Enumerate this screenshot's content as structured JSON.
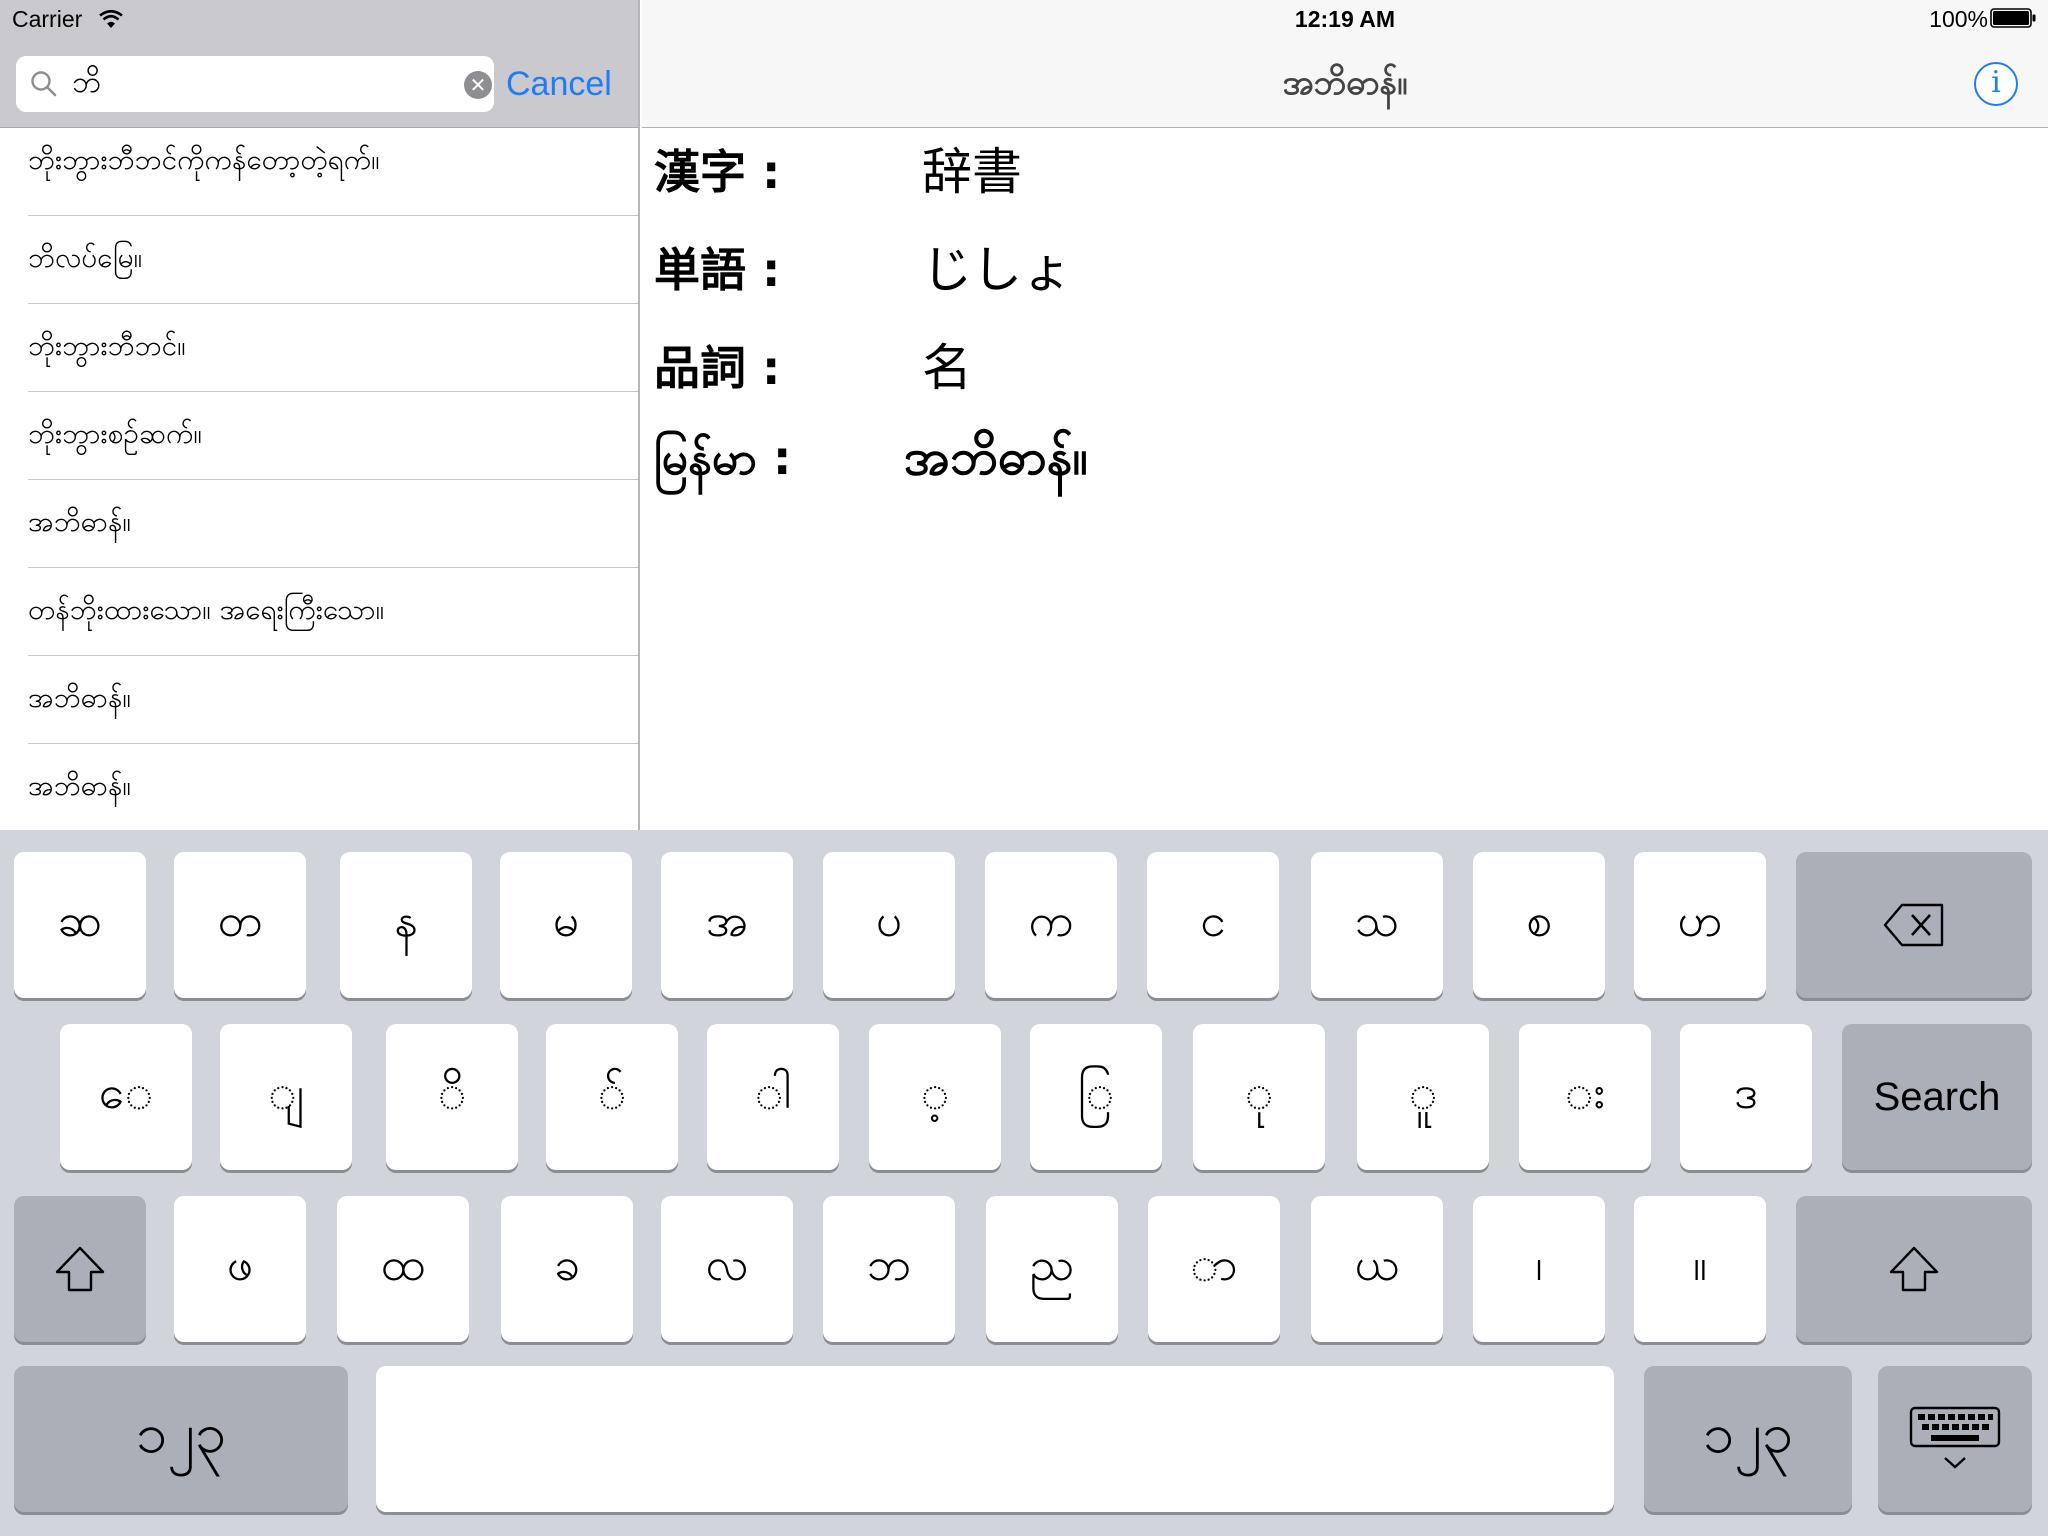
{
  "status_bar": {
    "carrier": "Carrier",
    "time": "12:19 AM",
    "battery": "100%"
  },
  "search": {
    "query": "ဘိ",
    "cancel_label": "Cancel"
  },
  "results": [
    "ဘိုးဘွားဘီဘင်ကိုကန်တော့တဲ့ရက်။",
    "ဘိလပ်မြေ။",
    "ဘိုးဘွားဘီဘင်။",
    "ဘိုးဘွားစဉ်ဆက်။",
    "အဘိဓာန်။",
    "တန်ဘိုးထားသော။ အရေးကြီးသော။",
    "အဘိဓာန်။",
    "အဘိဓာန်။"
  ],
  "detail": {
    "nav_title": "အဘိဓာန်။",
    "info_label": "i",
    "rows": [
      {
        "label": "漢字 :",
        "value": "辞書"
      },
      {
        "label": "単語 :",
        "value": "じしょ"
      },
      {
        "label": "品詞 :",
        "value": "名"
      },
      {
        "label": "မြန်မာ :",
        "value": "အဘိဓာန်။"
      }
    ]
  },
  "keyboard": {
    "row1": [
      "ဆ",
      "တ",
      "န",
      "မ",
      "အ",
      "ပ",
      "က",
      "င",
      "သ",
      "စ",
      "ဟ"
    ],
    "row2": [
      "ေ",
      "ျ",
      "ိ",
      "်",
      "ါ",
      "့",
      "ြ",
      "ု",
      "ူ",
      "း",
      "ဒ"
    ],
    "row3": [
      "ဖ",
      "ထ",
      "ခ",
      "လ",
      "ဘ",
      "ည",
      "ာ",
      "ယ",
      "၊",
      "။"
    ],
    "search_label": "Search",
    "numbers_label": "၁၂၃"
  }
}
